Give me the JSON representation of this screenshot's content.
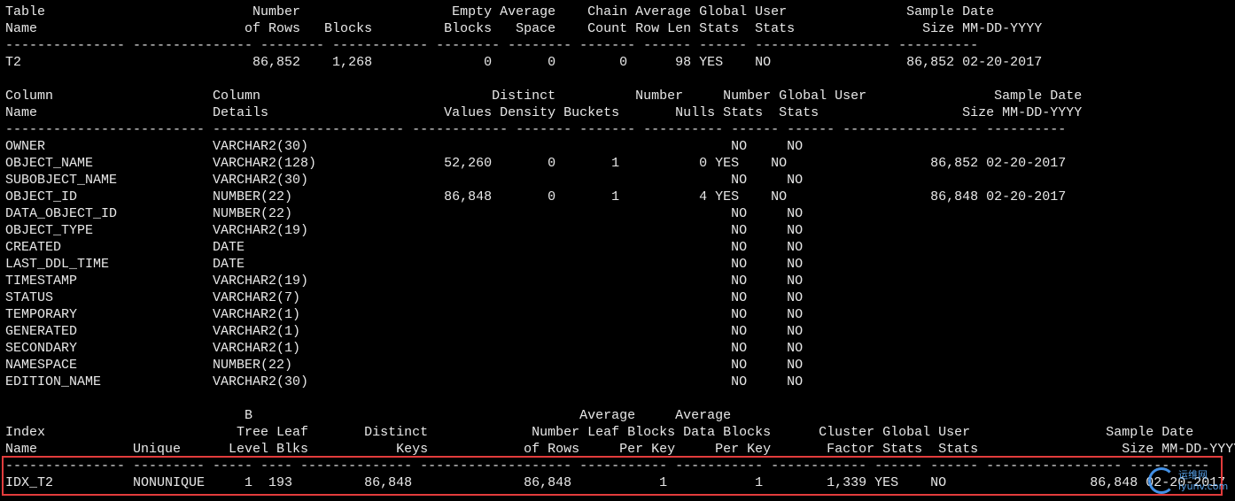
{
  "lines": [
    "Table                          Number                   Empty Average    Chain Average Global User               Sample Date",
    "Name                          of Rows   Blocks         Blocks   Space    Count Row Len Stats  Stats                Size MM-DD-YYYY",
    "--------------- --------------- -------- ------------ -------- -------- ------- ------ ------ ----------------- ----------",
    "T2                             86,852    1,268              0       0        0      98 YES    NO                 86,852 02-20-2017",
    "",
    "Column                    Column                             Distinct          Number     Number Global User                Sample Date",
    "Name                      Details                      Values Density Buckets       Nulls Stats  Stats                  Size MM-DD-YYYY",
    "------------------------- ------------------------ ------------ ------- ------- ---------- ------ ------ ----------------- ----------",
    "OWNER                     VARCHAR2(30)                                                     NO     NO",
    "OBJECT_NAME               VARCHAR2(128)                52,260       0       1          0 YES    NO                  86,852 02-20-2017",
    "SUBOBJECT_NAME            VARCHAR2(30)                                                     NO     NO",
    "OBJECT_ID                 NUMBER(22)                   86,848       0       1          4 YES    NO                  86,848 02-20-2017",
    "DATA_OBJECT_ID            NUMBER(22)                                                       NO     NO",
    "OBJECT_TYPE               VARCHAR2(19)                                                     NO     NO",
    "CREATED                   DATE                                                             NO     NO",
    "LAST_DDL_TIME             DATE                                                             NO     NO",
    "TIMESTAMP                 VARCHAR2(19)                                                     NO     NO",
    "STATUS                    VARCHAR2(7)                                                      NO     NO",
    "TEMPORARY                 VARCHAR2(1)                                                      NO     NO",
    "GENERATED                 VARCHAR2(1)                                                      NO     NO",
    "SECONDARY                 VARCHAR2(1)                                                      NO     NO",
    "NAMESPACE                 NUMBER(22)                                                       NO     NO",
    "EDITION_NAME              VARCHAR2(30)                                                     NO     NO",
    "",
    "                              B                                         Average     Average",
    "Index                        Tree Leaf       Distinct             Number Leaf Blocks Data Blocks      Cluster Global User                 Sample Date",
    "Name            Unique      Level Blks           Keys            of Rows     Per Key     Per Key       Factor Stats  Stats                  Size MM-DD-YYYY",
    "--------------- --------- ----- ---- -------------- ------------------- ----------- ----------- ------------ ------ ------ ----------------- ----------",
    "IDX_T2          NONUNIQUE     1  193         86,848              86,848           1           1        1,339 YES    NO                  86,848 02-20-2017"
  ],
  "watermark": {
    "line1": "运维网",
    "line2": "iyunv.com"
  }
}
